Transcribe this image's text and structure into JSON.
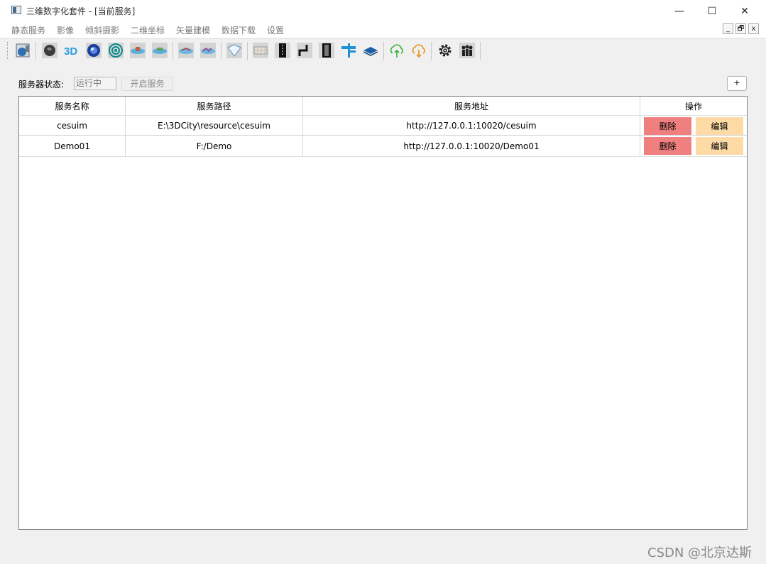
{
  "window": {
    "title": "三维数字化套件 - [当前服务]",
    "minimize": "—",
    "maximize": "☐",
    "close": "✕"
  },
  "menu": [
    "静态服务",
    "影像",
    "倾斜摄影",
    "二维坐标",
    "矢量建模",
    "数据下载",
    "设置"
  ],
  "mdi": {
    "minimize": "_",
    "restore": "🗗",
    "close": "x"
  },
  "toolbar": {
    "icons": [
      "globe-import-icon",
      "earth-dark-icon",
      "3d-text-icon",
      "earth-blue-icon",
      "radar-icon",
      "tilt-model-icon",
      "tilt-model-2-icon",
      "vector-icon",
      "vector-2-icon",
      "map-sheet-icon",
      "grid-tile-icon",
      "film-strip-icon",
      "route-icon",
      "film-strip-2-icon",
      "signpost-icon",
      "layer-icon",
      "cloud-upload-icon",
      "cloud-download-icon",
      "gear-icon",
      "users-icon"
    ],
    "text_3d": "3D"
  },
  "server": {
    "status_label": "服务器状态:",
    "status_value": "运行中",
    "start_button": "开启服务",
    "add_button": "+"
  },
  "table": {
    "headers": [
      "服务名称",
      "服务路径",
      "服务地址",
      "操作"
    ],
    "rows": [
      {
        "name": "cesuim",
        "path": "E:\\3DCity\\resource\\cesuim",
        "url": "http://127.0.0.1:10020/cesuim",
        "delete": "删除",
        "edit": "编辑"
      },
      {
        "name": "Demo01",
        "path": "F:/Demo",
        "url": "http://127.0.0.1:10020/Demo01",
        "delete": "删除",
        "edit": "编辑"
      }
    ]
  },
  "watermark": "CSDN @北京达斯",
  "colors": {
    "delete": "#f08080",
    "edit": "#fddaa6",
    "accent_blue": "#1e90d6"
  }
}
